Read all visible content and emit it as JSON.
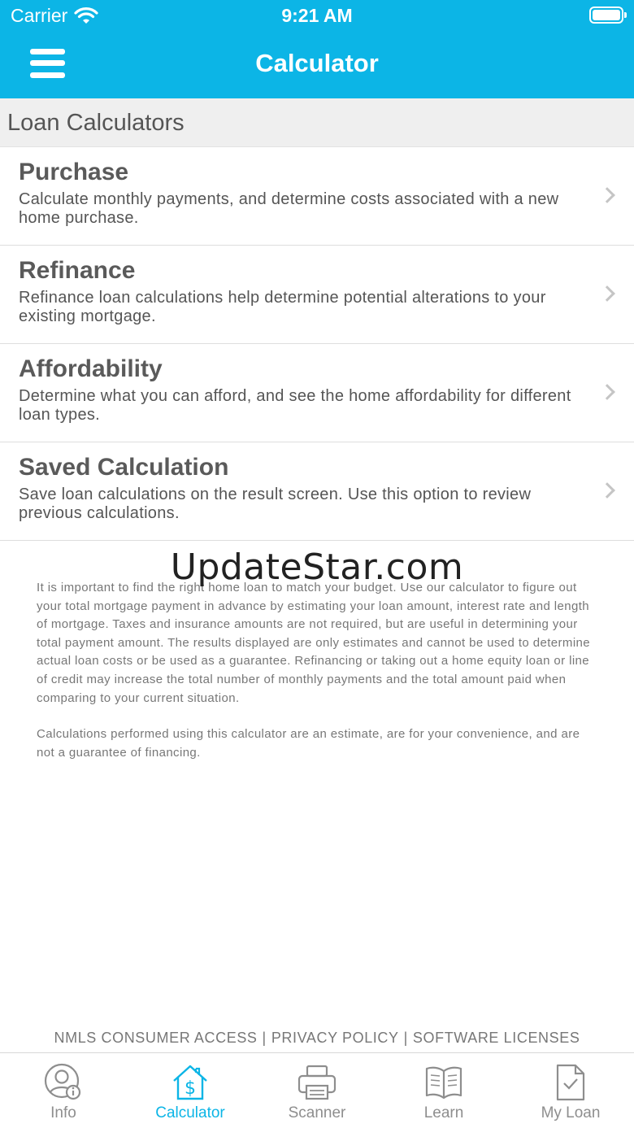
{
  "status_bar": {
    "carrier": "Carrier",
    "time": "9:21 AM"
  },
  "nav": {
    "title": "Calculator",
    "menu_icon": "hamburger-menu-icon"
  },
  "section": {
    "title": "Loan Calculators"
  },
  "calculators": [
    {
      "title": "Purchase",
      "description": "Calculate monthly payments, and determine costs associated with a new home purchase."
    },
    {
      "title": "Refinance",
      "description": "Refinance loan calculations help determine potential alterations to your existing mortgage."
    },
    {
      "title": "Affordability",
      "description": "Determine what you can afford, and see the home affordability for different loan types."
    },
    {
      "title": "Saved Calculation",
      "description": "Save loan calculations on the result screen. Use this option to review previous calculations."
    }
  ],
  "watermark": "UpdateStar.com",
  "disclaimer": {
    "paragraph1": "It is important to find the right home loan to match your budget. Use our calculator to figure out your total mortgage payment in advance by estimating your loan amount, interest rate and length of mortgage. Taxes and insurance amounts are not required, but are useful in determining your total payment amount. The results displayed are only estimates and cannot be used to determine actual loan costs or be used as a guarantee. Refinancing or taking out a home equity loan or line of credit may increase the total number of monthly payments and the total amount paid when comparing to your current situation.",
    "paragraph2": "Calculations performed using this calculator are an estimate, are for your convenience, and are not a guarantee of financing."
  },
  "footer_links": {
    "nmls": "NMLS CONSUMER ACCESS",
    "privacy": "PRIVACY POLICY",
    "licenses": "SOFTWARE LICENSES",
    "separator": "|"
  },
  "tabs": [
    {
      "label": "Info",
      "icon": "person-info-icon",
      "active": false
    },
    {
      "label": "Calculator",
      "icon": "house-dollar-icon",
      "active": true
    },
    {
      "label": "Scanner",
      "icon": "printer-icon",
      "active": false
    },
    {
      "label": "Learn",
      "icon": "open-book-icon",
      "active": false
    },
    {
      "label": "My Loan",
      "icon": "document-check-icon",
      "active": false
    }
  ],
  "colors": {
    "accent": "#0cb5e6",
    "inactive_tab": "#8e8e8e",
    "header_bg": "#efefef"
  }
}
